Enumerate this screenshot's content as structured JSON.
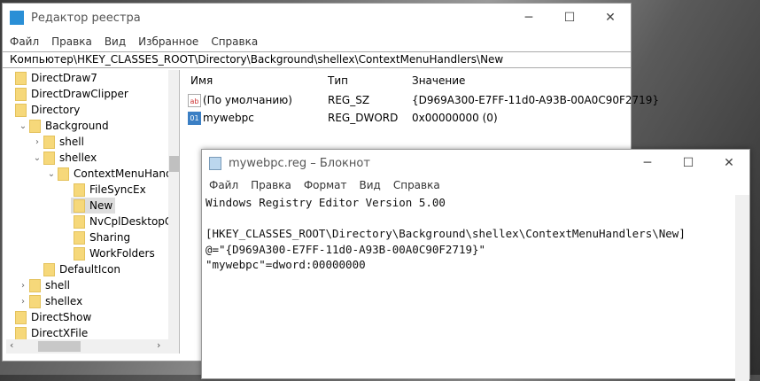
{
  "regedit": {
    "title": "Редактор реестра",
    "menu": [
      "Файл",
      "Правка",
      "Вид",
      "Избранное",
      "Справка"
    ],
    "address": "Компьютер\\HKEY_CLASSES_ROOT\\Directory\\Background\\shellex\\ContextMenuHandlers\\New",
    "tree": [
      "DirectDraw7",
      "DirectDrawClipper",
      "Directory",
      "Background",
      "shell",
      "shellex",
      "ContextMenuHand",
      "FileSyncEx",
      "New",
      "NvCplDesktopC",
      "Sharing",
      "WorkFolders",
      "DefaultIcon",
      "shell",
      "shellex",
      "DirectShow",
      "DirectXFile"
    ],
    "columns": [
      "Имя",
      "Тип",
      "Значение"
    ],
    "rows": [
      {
        "name": "(По умолчанию)",
        "type": "REG_SZ",
        "value": "{D969A300-E7FF-11d0-A93B-00A0C90F2719}"
      },
      {
        "name": "mywebpc",
        "type": "REG_DWORD",
        "value": "0x00000000 (0)"
      }
    ]
  },
  "notepad": {
    "title": "mywebpc.reg – Блокнот",
    "menu": [
      "Файл",
      "Правка",
      "Формат",
      "Вид",
      "Справка"
    ],
    "lines": [
      "Windows Registry Editor Version 5.00",
      "",
      "[HKEY_CLASSES_ROOT\\Directory\\Background\\shellex\\ContextMenuHandlers\\New]",
      "@=\"{D969A300-E7FF-11d0-A93B-00A0C90F2719}\"",
      "\"mywebpc\"=dword:00000000"
    ]
  }
}
